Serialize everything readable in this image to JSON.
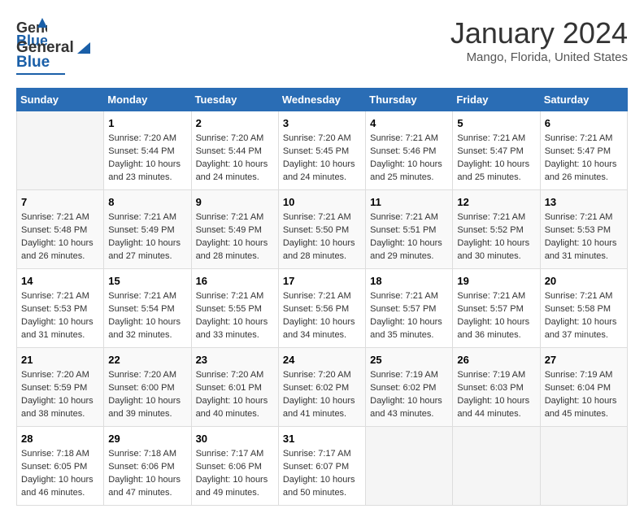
{
  "logo": {
    "line1": "General",
    "line2": "Blue"
  },
  "header": {
    "title": "January 2024",
    "subtitle": "Mango, Florida, United States"
  },
  "weekdays": [
    "Sunday",
    "Monday",
    "Tuesday",
    "Wednesday",
    "Thursday",
    "Friday",
    "Saturday"
  ],
  "weeks": [
    [
      {
        "day": "",
        "detail": ""
      },
      {
        "day": "1",
        "detail": "Sunrise: 7:20 AM\nSunset: 5:44 PM\nDaylight: 10 hours\nand 23 minutes."
      },
      {
        "day": "2",
        "detail": "Sunrise: 7:20 AM\nSunset: 5:44 PM\nDaylight: 10 hours\nand 24 minutes."
      },
      {
        "day": "3",
        "detail": "Sunrise: 7:20 AM\nSunset: 5:45 PM\nDaylight: 10 hours\nand 24 minutes."
      },
      {
        "day": "4",
        "detail": "Sunrise: 7:21 AM\nSunset: 5:46 PM\nDaylight: 10 hours\nand 25 minutes."
      },
      {
        "day": "5",
        "detail": "Sunrise: 7:21 AM\nSunset: 5:47 PM\nDaylight: 10 hours\nand 25 minutes."
      },
      {
        "day": "6",
        "detail": "Sunrise: 7:21 AM\nSunset: 5:47 PM\nDaylight: 10 hours\nand 26 minutes."
      }
    ],
    [
      {
        "day": "7",
        "detail": "Sunrise: 7:21 AM\nSunset: 5:48 PM\nDaylight: 10 hours\nand 26 minutes."
      },
      {
        "day": "8",
        "detail": "Sunrise: 7:21 AM\nSunset: 5:49 PM\nDaylight: 10 hours\nand 27 minutes."
      },
      {
        "day": "9",
        "detail": "Sunrise: 7:21 AM\nSunset: 5:49 PM\nDaylight: 10 hours\nand 28 minutes."
      },
      {
        "day": "10",
        "detail": "Sunrise: 7:21 AM\nSunset: 5:50 PM\nDaylight: 10 hours\nand 28 minutes."
      },
      {
        "day": "11",
        "detail": "Sunrise: 7:21 AM\nSunset: 5:51 PM\nDaylight: 10 hours\nand 29 minutes."
      },
      {
        "day": "12",
        "detail": "Sunrise: 7:21 AM\nSunset: 5:52 PM\nDaylight: 10 hours\nand 30 minutes."
      },
      {
        "day": "13",
        "detail": "Sunrise: 7:21 AM\nSunset: 5:53 PM\nDaylight: 10 hours\nand 31 minutes."
      }
    ],
    [
      {
        "day": "14",
        "detail": "Sunrise: 7:21 AM\nSunset: 5:53 PM\nDaylight: 10 hours\nand 31 minutes."
      },
      {
        "day": "15",
        "detail": "Sunrise: 7:21 AM\nSunset: 5:54 PM\nDaylight: 10 hours\nand 32 minutes."
      },
      {
        "day": "16",
        "detail": "Sunrise: 7:21 AM\nSunset: 5:55 PM\nDaylight: 10 hours\nand 33 minutes."
      },
      {
        "day": "17",
        "detail": "Sunrise: 7:21 AM\nSunset: 5:56 PM\nDaylight: 10 hours\nand 34 minutes."
      },
      {
        "day": "18",
        "detail": "Sunrise: 7:21 AM\nSunset: 5:57 PM\nDaylight: 10 hours\nand 35 minutes."
      },
      {
        "day": "19",
        "detail": "Sunrise: 7:21 AM\nSunset: 5:57 PM\nDaylight: 10 hours\nand 36 minutes."
      },
      {
        "day": "20",
        "detail": "Sunrise: 7:21 AM\nSunset: 5:58 PM\nDaylight: 10 hours\nand 37 minutes."
      }
    ],
    [
      {
        "day": "21",
        "detail": "Sunrise: 7:20 AM\nSunset: 5:59 PM\nDaylight: 10 hours\nand 38 minutes."
      },
      {
        "day": "22",
        "detail": "Sunrise: 7:20 AM\nSunset: 6:00 PM\nDaylight: 10 hours\nand 39 minutes."
      },
      {
        "day": "23",
        "detail": "Sunrise: 7:20 AM\nSunset: 6:01 PM\nDaylight: 10 hours\nand 40 minutes."
      },
      {
        "day": "24",
        "detail": "Sunrise: 7:20 AM\nSunset: 6:02 PM\nDaylight: 10 hours\nand 41 minutes."
      },
      {
        "day": "25",
        "detail": "Sunrise: 7:19 AM\nSunset: 6:02 PM\nDaylight: 10 hours\nand 43 minutes."
      },
      {
        "day": "26",
        "detail": "Sunrise: 7:19 AM\nSunset: 6:03 PM\nDaylight: 10 hours\nand 44 minutes."
      },
      {
        "day": "27",
        "detail": "Sunrise: 7:19 AM\nSunset: 6:04 PM\nDaylight: 10 hours\nand 45 minutes."
      }
    ],
    [
      {
        "day": "28",
        "detail": "Sunrise: 7:18 AM\nSunset: 6:05 PM\nDaylight: 10 hours\nand 46 minutes."
      },
      {
        "day": "29",
        "detail": "Sunrise: 7:18 AM\nSunset: 6:06 PM\nDaylight: 10 hours\nand 47 minutes."
      },
      {
        "day": "30",
        "detail": "Sunrise: 7:17 AM\nSunset: 6:06 PM\nDaylight: 10 hours\nand 49 minutes."
      },
      {
        "day": "31",
        "detail": "Sunrise: 7:17 AM\nSunset: 6:07 PM\nDaylight: 10 hours\nand 50 minutes."
      },
      {
        "day": "",
        "detail": ""
      },
      {
        "day": "",
        "detail": ""
      },
      {
        "day": "",
        "detail": ""
      }
    ]
  ]
}
